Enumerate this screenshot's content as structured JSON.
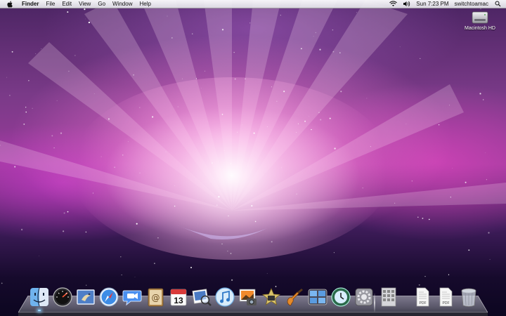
{
  "menubar": {
    "app_name": "Finder",
    "menus": [
      "File",
      "Edit",
      "View",
      "Go",
      "Window",
      "Help"
    ],
    "clock": "Sun 7:23 PM",
    "user": "switchtoamac",
    "icons": [
      "apple-icon",
      "wifi-icon",
      "volume-icon",
      "spotlight-icon"
    ]
  },
  "desktop": {
    "icons": [
      {
        "label": "Macintosh HD",
        "icon": "hard-drive-icon"
      }
    ]
  },
  "dock": {
    "apps": [
      {
        "icon": "finder-icon",
        "running": true
      },
      {
        "icon": "dashboard-icon",
        "running": false
      },
      {
        "icon": "mail-icon",
        "running": false
      },
      {
        "icon": "safari-icon",
        "running": false
      },
      {
        "icon": "ichat-icon",
        "running": false
      },
      {
        "icon": "address-book-icon",
        "running": false
      },
      {
        "icon": "ical-icon",
        "running": false,
        "date": "13"
      },
      {
        "icon": "preview-icon",
        "running": false
      },
      {
        "icon": "itunes-icon",
        "running": false
      },
      {
        "icon": "iphoto-icon",
        "running": false
      },
      {
        "icon": "imovie-icon",
        "running": false
      },
      {
        "icon": "garageband-icon",
        "running": false
      },
      {
        "icon": "spaces-icon",
        "running": false
      },
      {
        "icon": "time-machine-icon",
        "running": false
      },
      {
        "icon": "system-preferences-icon",
        "running": false
      }
    ],
    "others": [
      {
        "icon": "applications-stack-icon"
      },
      {
        "icon": "pdf-document-icon",
        "badge": "PDF"
      },
      {
        "icon": "pdf-document-icon",
        "badge": "PDF"
      },
      {
        "icon": "trash-icon"
      }
    ]
  },
  "colors": {
    "indicator": "#9fd8ff",
    "wallpaper_core": "#f678d6"
  }
}
